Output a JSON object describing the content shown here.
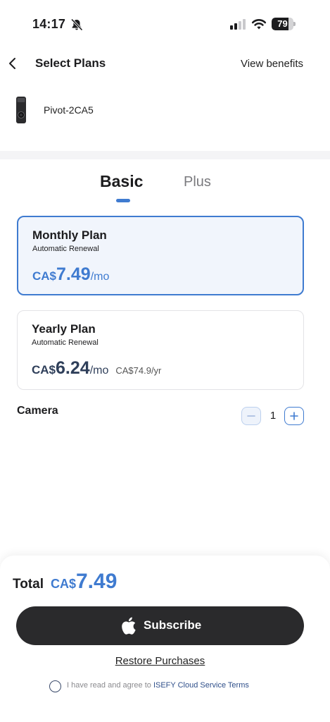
{
  "status_bar": {
    "time": "14:17",
    "battery": "79",
    "battery_level": 0.79
  },
  "nav": {
    "title": "Select Plans",
    "view_benefits": "View benefits"
  },
  "device": {
    "name": "Pivot-2CA5"
  },
  "tabs": [
    {
      "label": "Basic",
      "selected": true
    },
    {
      "label": "Plus",
      "selected": false
    }
  ],
  "plans": [
    {
      "name": "Monthly Plan",
      "renewal": "Automatic Renewal",
      "currency": "CA$",
      "amount": "7.49",
      "unit": "/mo",
      "selected": true
    },
    {
      "name": "Yearly Plan",
      "renewal": "Automatic Renewal",
      "currency": "CA$",
      "amount": "6.24",
      "unit": "/mo",
      "yearly_total": "CA$74.9/yr",
      "selected": false
    }
  ],
  "camera": {
    "label": "Camera",
    "quantity": "1"
  },
  "total": {
    "label": "Total",
    "currency": "CA$",
    "amount": "7.49"
  },
  "subscribe": {
    "label": "Subscribe"
  },
  "restore": {
    "label": "Restore Purchases"
  },
  "agreement": {
    "text": "I have read and agree to ",
    "link": "ISEFY Cloud Service Terms"
  },
  "colors": {
    "accent": "#3f7bd0",
    "button": "#2a2a2c"
  }
}
